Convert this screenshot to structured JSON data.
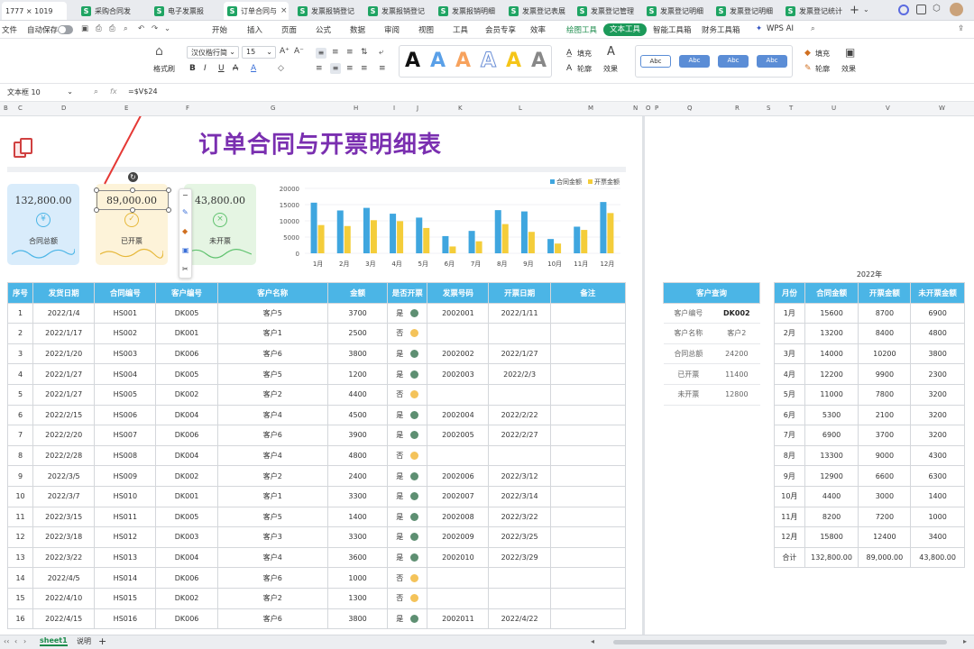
{
  "tabs": [
    {
      "label": "1777 × 1019"
    },
    {
      "label": "采购合同发"
    },
    {
      "label": "电子发票报"
    },
    {
      "label": "订单合同与"
    },
    {
      "label": "发票报销登记"
    },
    {
      "label": "发票报销登记"
    },
    {
      "label": "发票报销明细"
    },
    {
      "label": "发票登记表展"
    },
    {
      "label": "发票登记管理"
    },
    {
      "label": "发票登记明细"
    },
    {
      "label": "发票登记明细"
    },
    {
      "label": "发票登记统计"
    }
  ],
  "menu": {
    "file": "文件",
    "autosave": "自动保存",
    "items": [
      "开始",
      "插入",
      "页面",
      "公式",
      "数据",
      "审阅",
      "视图",
      "工具",
      "会员专享",
      "效率"
    ],
    "draw_tools": "绘图工具",
    "text_tools": "文本工具",
    "smart": "智能工具箱",
    "finance": "财务工具箱",
    "wps_ai": "WPS AI"
  },
  "ribbon": {
    "format_painter": "格式刷",
    "font": "汉仪楷行简",
    "size": "15",
    "fill": "填充",
    "outline": "轮廓",
    "effect": "效果",
    "shape_labels": [
      "Abc",
      "Abc",
      "Abc",
      "Abc"
    ],
    "fill2": "填充",
    "outline2": "轮廓",
    "effect2": "效果"
  },
  "formula": {
    "namebox": "文本框 10",
    "fx": "fx",
    "formula": "=$V$24"
  },
  "columns": [
    "B",
    "C",
    "D",
    "E",
    "F",
    "G",
    "H",
    "I",
    "J",
    "K",
    "L",
    "M",
    "N",
    "O",
    "P",
    "Q",
    "R",
    "S",
    "T",
    "U",
    "V",
    "W"
  ],
  "sheet": {
    "title": "订单合同与开票明细表",
    "cards": [
      {
        "value": "132,800.00",
        "label": "合同总额"
      },
      {
        "value": "89,000.00",
        "label": "已开票"
      },
      {
        "value": "43,800.00",
        "label": "未开票"
      }
    ],
    "headers": [
      "序号",
      "发货日期",
      "合同编号",
      "客户编号",
      "客户名称",
      "金额",
      "是否开票",
      "发票号码",
      "开票日期",
      "备注"
    ],
    "rows": [
      [
        "1",
        "2022/1/4",
        "HS001",
        "DK005",
        "客户5",
        "3700",
        "是",
        "2002001",
        "2022/1/11"
      ],
      [
        "2",
        "2022/1/17",
        "HS002",
        "DK001",
        "客户1",
        "2500",
        "否",
        "",
        ""
      ],
      [
        "3",
        "2022/1/20",
        "HS003",
        "DK006",
        "客户6",
        "3800",
        "是",
        "2002002",
        "2022/1/27"
      ],
      [
        "4",
        "2022/1/27",
        "HS004",
        "DK005",
        "客户5",
        "1200",
        "是",
        "2002003",
        "2022/2/3"
      ],
      [
        "5",
        "2022/1/27",
        "HS005",
        "DK002",
        "客户2",
        "4400",
        "否",
        "",
        ""
      ],
      [
        "6",
        "2022/2/15",
        "HS006",
        "DK004",
        "客户4",
        "4500",
        "是",
        "2002004",
        "2022/2/22"
      ],
      [
        "7",
        "2022/2/20",
        "HS007",
        "DK006",
        "客户6",
        "3900",
        "是",
        "2002005",
        "2022/2/27"
      ],
      [
        "8",
        "2022/2/28",
        "HS008",
        "DK004",
        "客户4",
        "4800",
        "否",
        "",
        ""
      ],
      [
        "9",
        "2022/3/5",
        "HS009",
        "DK002",
        "客户2",
        "2400",
        "是",
        "2002006",
        "2022/3/12"
      ],
      [
        "10",
        "2022/3/7",
        "HS010",
        "DK001",
        "客户1",
        "3300",
        "是",
        "2002007",
        "2022/3/14"
      ],
      [
        "11",
        "2022/3/15",
        "HS011",
        "DK005",
        "客户5",
        "1400",
        "是",
        "2002008",
        "2022/3/22"
      ],
      [
        "12",
        "2022/3/18",
        "HS012",
        "DK003",
        "客户3",
        "3300",
        "是",
        "2002009",
        "2022/3/25"
      ],
      [
        "13",
        "2022/3/22",
        "HS013",
        "DK004",
        "客户4",
        "3600",
        "是",
        "2002010",
        "2022/3/29"
      ],
      [
        "14",
        "2022/4/5",
        "HS014",
        "DK006",
        "客户6",
        "1000",
        "否",
        "",
        ""
      ],
      [
        "15",
        "2022/4/10",
        "HS015",
        "DK002",
        "客户2",
        "1300",
        "否",
        "",
        ""
      ],
      [
        "16",
        "2022/4/15",
        "HS016",
        "DK006",
        "客户6",
        "3800",
        "是",
        "2002011",
        "2022/4/22"
      ]
    ],
    "query": {
      "title": "客户查询",
      "rows": [
        [
          "客户编号",
          "DK002"
        ],
        [
          "客户名称",
          "客户2"
        ],
        [
          "合同总额",
          "24200"
        ],
        [
          "已开票",
          "11400"
        ],
        [
          "未开票",
          "12800"
        ]
      ]
    },
    "monthly": {
      "year": "2022年",
      "headers": [
        "月份",
        "合同金额",
        "开票金额",
        "未开票金额"
      ],
      "rows": [
        [
          "1月",
          "15600",
          "8700",
          "6900"
        ],
        [
          "2月",
          "13200",
          "8400",
          "4800"
        ],
        [
          "3月",
          "14000",
          "10200",
          "3800"
        ],
        [
          "4月",
          "12200",
          "9900",
          "2300"
        ],
        [
          "5月",
          "11000",
          "7800",
          "3200"
        ],
        [
          "6月",
          "5300",
          "2100",
          "3200"
        ],
        [
          "7月",
          "6900",
          "3700",
          "3200"
        ],
        [
          "8月",
          "13300",
          "9000",
          "4300"
        ],
        [
          "9月",
          "12900",
          "6600",
          "6300"
        ],
        [
          "10月",
          "4400",
          "3000",
          "1400"
        ],
        [
          "11月",
          "8200",
          "7200",
          "1000"
        ],
        [
          "12月",
          "15800",
          "12400",
          "3400"
        ],
        [
          "合计",
          "132,800.00",
          "89,000.00",
          "43,800.00"
        ]
      ]
    }
  },
  "chart_data": {
    "type": "bar",
    "categories": [
      "1月",
      "2月",
      "3月",
      "4月",
      "5月",
      "6月",
      "7月",
      "8月",
      "9月",
      "10月",
      "11月",
      "12月"
    ],
    "series": [
      {
        "name": "合同金额",
        "values": [
          15600,
          13200,
          14000,
          12200,
          11000,
          5300,
          6900,
          13300,
          12900,
          4400,
          8200,
          15800
        ],
        "color": "#3fa6df"
      },
      {
        "name": "开票金额",
        "values": [
          8700,
          8400,
          10200,
          9900,
          7800,
          2100,
          3700,
          9000,
          6600,
          3000,
          7200,
          12400
        ],
        "color": "#f4cd3a"
      }
    ],
    "yticks": [
      "20000",
      "15000",
      "10000",
      "5000",
      "0"
    ],
    "ylim": [
      0,
      20000
    ],
    "legend": "top-right"
  },
  "sheettabs": {
    "tabs": [
      "sheet1",
      "说明"
    ]
  }
}
